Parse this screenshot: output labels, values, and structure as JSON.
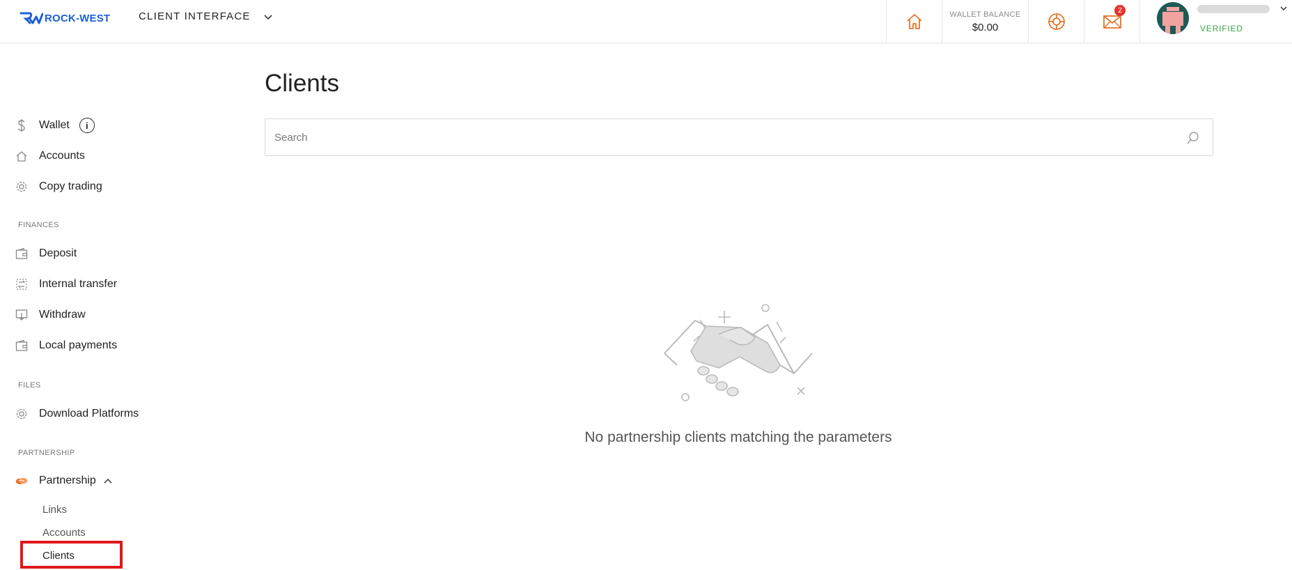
{
  "header": {
    "logo_text": "ROCK-WEST",
    "client_interface_label": "CLIENT INTERFACE",
    "wallet_balance_label": "WALLET BALANCE",
    "wallet_balance_value": "$0.00",
    "mail_badge_count": "2",
    "verified_label": "VERIFIED",
    "icons": [
      "home-icon",
      "support-icon",
      "mail-icon",
      "chevron-down-icon"
    ],
    "accent_color": "#e8742a"
  },
  "sidebar": {
    "main_items": [
      {
        "label": "Wallet",
        "icon": "dollar-icon"
      },
      {
        "label": "Accounts",
        "icon": "home-icon"
      },
      {
        "label": "Copy trading",
        "icon": "gear-icon"
      }
    ],
    "finances_title": "FINANCES",
    "finances_items": [
      {
        "label": "Deposit",
        "icon": "wallet-icon"
      },
      {
        "label": "Internal transfer",
        "icon": "transfer-icon"
      },
      {
        "label": "Withdraw",
        "icon": "withdraw-icon"
      },
      {
        "label": "Local payments",
        "icon": "wallet-icon"
      }
    ],
    "files_title": "FILES",
    "files_items": [
      {
        "label": "Download Platforms",
        "icon": "gear-icon"
      }
    ],
    "partnership_title": "PARTNERSHIP",
    "partnership_label": "Partnership",
    "partnership_subitems": [
      "Links",
      "Accounts",
      "Clients"
    ],
    "active_subitem": "Clients"
  },
  "main": {
    "title": "Clients",
    "search_placeholder": "Search",
    "empty_message": "No partnership clients matching the parameters"
  }
}
